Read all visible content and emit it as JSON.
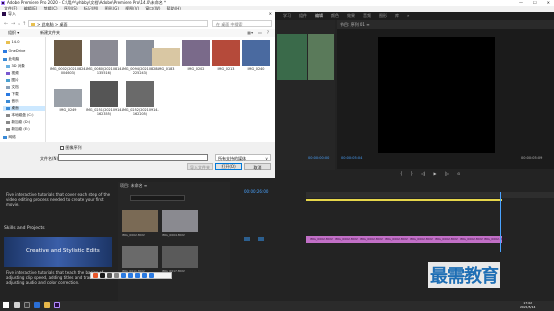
{
  "premiere": {
    "title": "Adobe Premiere Pro 2020 - C:\\用户\\yhbby\\文档\\Adobe\\Premiere Pro\\14.0\\未命名 *",
    "menu": [
      "文件(F)",
      "编辑(E)",
      "剪辑(C)",
      "序列(S)",
      "标记(M)",
      "图形(G)",
      "视图(V)",
      "窗口(W)",
      "帮助(H)"
    ],
    "workspaces": [
      "学习",
      "组件",
      "编辑",
      "颜色",
      "效果",
      "音频",
      "图形",
      "库",
      "»"
    ],
    "program_label": "节目: 序列 01 ≡",
    "program_tc_left": "00:00:05:04",
    "program_tc_right": "00:00:05:09",
    "source_tc": "00:00:00:00",
    "learn_text": "Five interactive tutorials that cover each step of the video editing process needed to create your first movie.",
    "skills_heading": "Skills and Projects",
    "skills_card_title": "Creative and Stylistic Edits",
    "skills_text": "Five interactive tutorials that teach the basics of adjusting clip speed, adding titles and transitions, adjusting audio and color correction.",
    "project_tab": "项目: 未命名 ≡",
    "timeline_tc": "00:00:26:00",
    "clips": [
      "IMG_0002.MOV",
      "IMG_0002.MOV",
      "IMG_0002.MOV",
      "IMG_0002.MOV",
      "IMG_0002.MOV",
      "IMG_0002.MOV",
      "IMG_0002.MOV",
      "IMG_0002.MOV"
    ],
    "project_items": [
      {
        "label": "IMG_0002.MOV"
      },
      {
        "label": "IMG_0004.MOV"
      },
      {
        "label": "IMG_0011.MOV"
      },
      {
        "label": "IMG_0017.MOV"
      }
    ]
  },
  "watermark": "最需教育",
  "taskbar": {
    "time": "17:02",
    "date": "2021/5/14"
  },
  "dialog": {
    "title": "导入",
    "path": "> 此电脑 > 桌面",
    "search_placeholder": "在 桌面 中搜索",
    "organize": "组织 ▾",
    "new_folder": "新建文件夹",
    "nav_items": [
      {
        "label": "14.0",
        "icon": "folder-icon"
      },
      {
        "label": "OneDrive",
        "icon": "cloud-icon"
      },
      {
        "label": "此电脑",
        "icon": "computer-icon"
      },
      {
        "label": "3D 对象",
        "icon": "cube-icon"
      },
      {
        "label": "视频",
        "icon": "video-icon"
      },
      {
        "label": "图片",
        "icon": "picture-icon"
      },
      {
        "label": "文档",
        "icon": "document-icon"
      },
      {
        "label": "下载",
        "icon": "download-icon"
      },
      {
        "label": "音乐",
        "icon": "music-icon"
      },
      {
        "label": "桌面",
        "icon": "desktop-icon"
      },
      {
        "label": "本地磁盘 (C:)",
        "icon": "drive-icon"
      },
      {
        "label": "新加卷 (D:)",
        "icon": "drive-icon"
      },
      {
        "label": "新加卷 (E:)",
        "icon": "drive-icon"
      },
      {
        "label": "网络",
        "icon": "network-icon"
      }
    ],
    "files": [
      {
        "name": "IMG_0002(20210824-004603)",
        "color": "#6b5a45"
      },
      {
        "name": "IMG_0080(20210814-135516)",
        "color": "#8a8a94"
      },
      {
        "name": "IMG_0094(20210828-225243)",
        "color": "#8a8f9a"
      },
      {
        "name": "IMG_0183",
        "color": "#d9c7a3"
      },
      {
        "name": "IMG_0202",
        "color": "#7a6a8a"
      },
      {
        "name": "IMG_0213",
        "color": "#b54a3a"
      },
      {
        "name": "IMG_0240",
        "color": "#4a6aa0"
      },
      {
        "name": "IMG_0249",
        "color": "#9aa0a8"
      },
      {
        "name": "IMG_0251(20210914-162355)",
        "color": "#555555"
      },
      {
        "name": "IMG_0252(20210914-162205)",
        "color": "#6a6a6a"
      }
    ],
    "image_sequence": "图像序列",
    "filename_label": "文件名(N):",
    "filename_value": "",
    "filetype": "所有支持的媒体",
    "import_folder": "导入文件夹",
    "open": "打开(O)",
    "cancel": "取消"
  }
}
